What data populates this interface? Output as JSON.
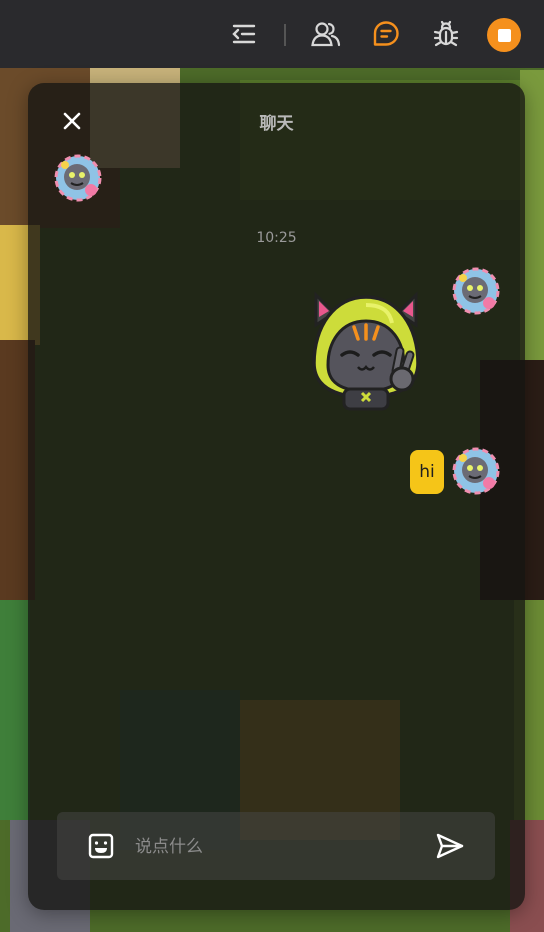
{
  "topbar": {
    "icons": [
      "menu-collapse-icon",
      "users-icon",
      "chat-icon",
      "bug-icon"
    ],
    "record_icon": "record-stop-icon",
    "colors": {
      "background": "#2a2a2d",
      "icon": "#d8d8d8",
      "active_icon": "#f5901d",
      "record_button": "#f5901d"
    }
  },
  "chat": {
    "title": "聊天",
    "close_icon": "close-icon",
    "timestamp": "10:25",
    "messages": [
      {
        "sender": "self",
        "type": "sticker",
        "sticker_icon": "cat-hoodie-peace-sticker"
      },
      {
        "sender": "self",
        "type": "text",
        "text": "hi"
      }
    ],
    "colors": {
      "bubble": "#f5c518",
      "bubble_text": "#1f1f1f"
    }
  },
  "input": {
    "placeholder": "说点什么",
    "value": "",
    "emoji_icon": "emoji-icon",
    "send_icon": "send-icon"
  }
}
